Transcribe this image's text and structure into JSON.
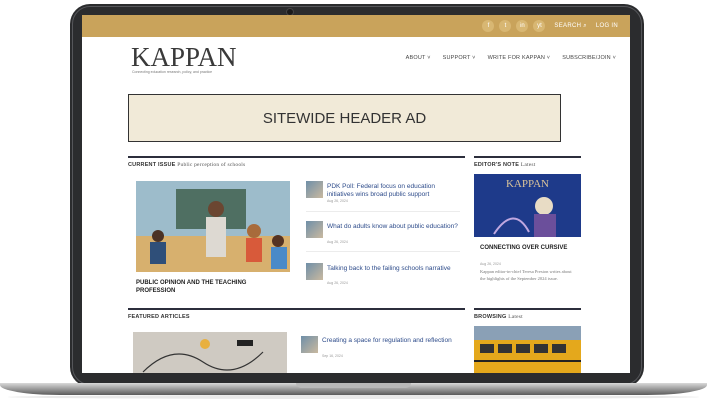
{
  "topbar": {
    "social": [
      "f",
      "t",
      "in",
      "yt"
    ],
    "search_label": "SEARCH ⌕",
    "login_label": "LOG IN"
  },
  "brand": {
    "logo": "KAPPAN",
    "tagline": "Connecting education research, policy, and practice"
  },
  "nav": [
    "ABOUT ˅",
    "SUPPORT ˅",
    "WRITE FOR KAPPAN ˅",
    "SUBSCRIBE/JOIN ˅"
  ],
  "ad": {
    "label": "SITEWIDE HEADER AD"
  },
  "current_issue": {
    "label": "CURRENT ISSUE",
    "sublabel": "Public perception of schools",
    "feature_caption": "PUBLIC OPINION AND THE TEACHING PROFESSION",
    "articles": [
      {
        "title": "PDK Poll: Federal focus on education initiatives wins broad public support",
        "date": "Aug 26, 2024"
      },
      {
        "title": "What do adults know about public education?",
        "date": "Aug 26, 2024"
      },
      {
        "title": "Talking back to the failing schools narrative",
        "date": "Aug 26, 2024"
      }
    ]
  },
  "editors_note": {
    "label": "EDITOR'S NOTE",
    "sublabel": "Latest",
    "cover_title": "KAPPAN",
    "headline": "CONNECTING OVER CURSIVE",
    "date": "Aug 26, 2024",
    "body": "Kappan editor-in-chief Teresa Preston writes about the highlights of the September 2024 issue."
  },
  "featured": {
    "label": "FEATURED ARTICLES",
    "articles": [
      {
        "title": "Creating a space for regulation and reflection",
        "date": "Sep 16, 2024"
      }
    ]
  },
  "browsing": {
    "label": "BROWSING",
    "sublabel": "Latest"
  },
  "colors": {
    "gold": "#c9a35b",
    "navy": "#2c2e3c",
    "ad_bg": "#f1ead8",
    "link": "#2d4b8a"
  }
}
